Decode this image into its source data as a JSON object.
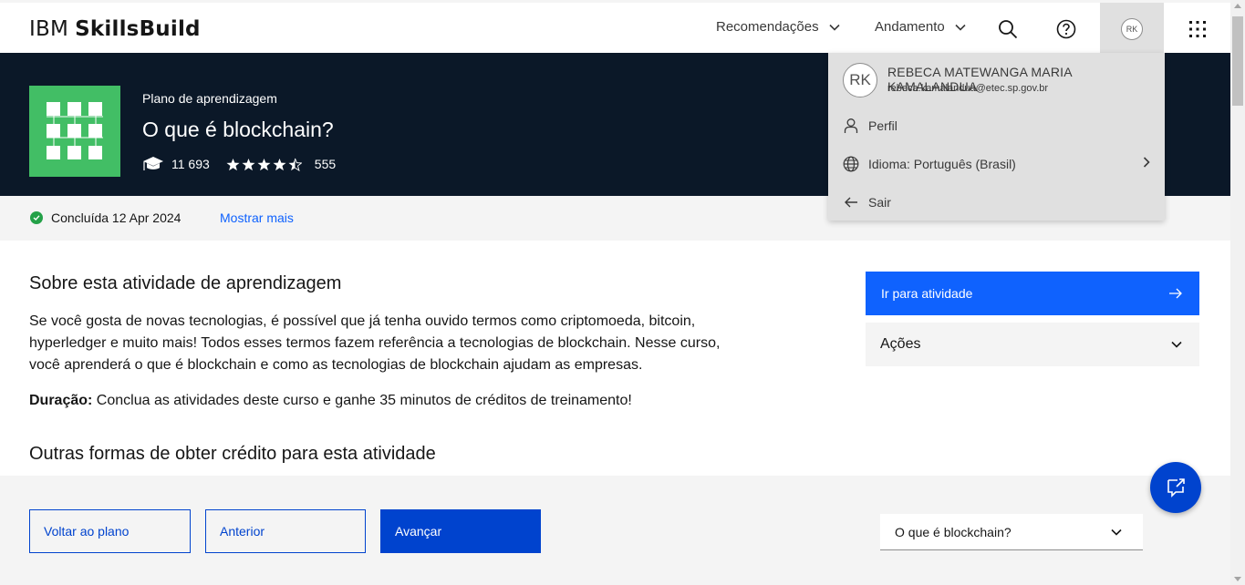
{
  "header": {
    "brand_light": "IBM",
    "brand_bold": "SkillsBuild",
    "nav": [
      {
        "label": "Recomendações",
        "icon": "chevron-down-icon"
      },
      {
        "label": "Andamento",
        "icon": "chevron-down-icon"
      }
    ],
    "avatar_initials": "RK"
  },
  "hero": {
    "kicker": "Plano de aprendizagem",
    "title": "O que é blockchain?",
    "learners": "11 693",
    "rating_stars": 4.5,
    "rating_count": "555",
    "logo_color": "#42be65",
    "bg_color": "#0b1828"
  },
  "status": {
    "completed_text": "Concluída 12 Apr 2024",
    "more_link": "Mostrar mais"
  },
  "about": {
    "heading": "Sobre esta atividade de aprendizagem",
    "paragraph": "Se você gosta de novas tecnologias, é possível que já tenha ouvido termos como criptomoeda, bitcoin, hyperledger e muito mais! Todos esses termos fazem referência a tecnologias de blockchain. Nesse curso, você aprenderá o que é blockchain e como as tecnologias de blockchain ajudam as empresas.",
    "duration_label": "Duração:",
    "duration_text": " Conclua as atividades deste curso e ganhe 35 minutos de créditos de treinamento!",
    "other_heading": "Outras formas de obter crédito para esta atividade"
  },
  "sidebar": {
    "go_button": "Ir para atividade",
    "actions_label": "Ações"
  },
  "footer": {
    "back_button": "Voltar ao plano",
    "prev_button": "Anterior",
    "next_button": "Avançar",
    "select_value": "O que é blockchain?"
  },
  "profile_menu": {
    "initials": "RK",
    "name": "REBECA MATEWANGA MARIA KAMALANDUA",
    "email": "rebeca.kamalandua@etec.sp.gov.br",
    "items": [
      {
        "label": "Perfil",
        "icon": "user-icon"
      },
      {
        "label": "Idioma: Português (Brasil)",
        "icon": "globe-icon"
      },
      {
        "label": "Sair",
        "icon": "arrow-left-icon"
      }
    ]
  },
  "colors": {
    "primary": "#0f62fe",
    "primary_dark": "#0043ce",
    "success": "#24a148"
  }
}
